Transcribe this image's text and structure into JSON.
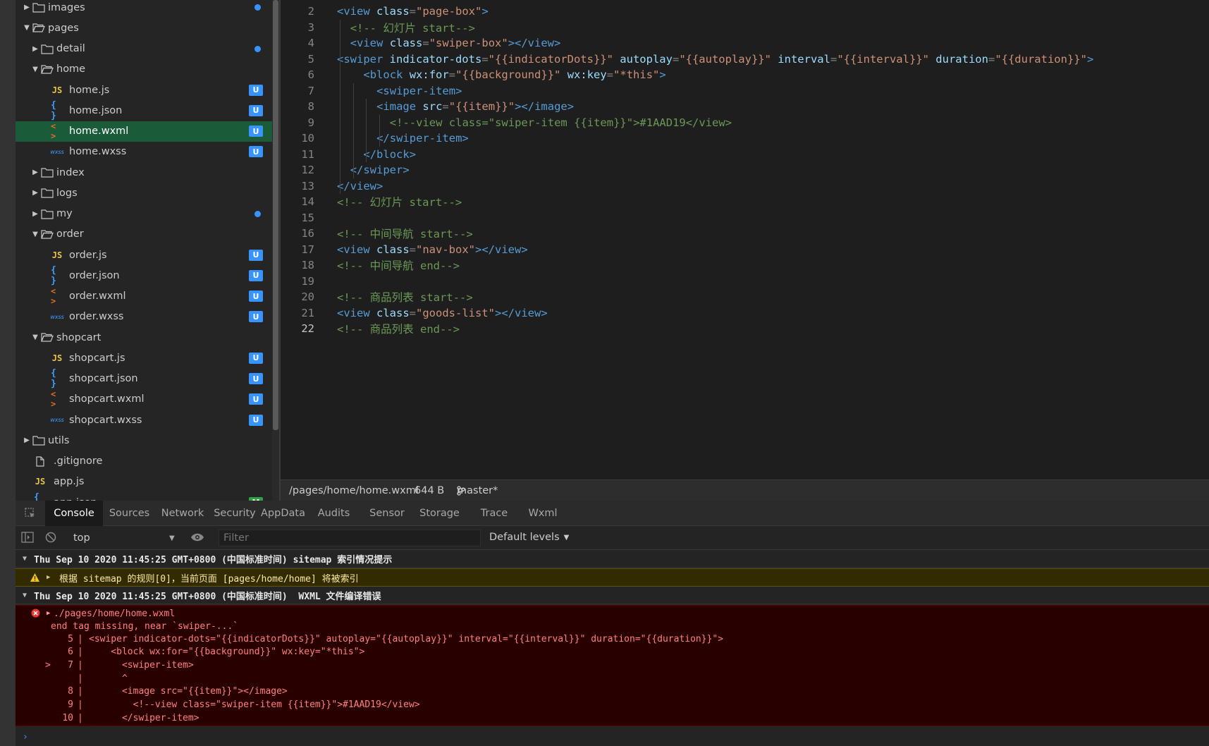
{
  "file_tree": {
    "items": [
      {
        "label": "images",
        "type": "folder",
        "expanded": false,
        "depth": 0,
        "status": "dot"
      },
      {
        "label": "pages",
        "type": "folder",
        "expanded": true,
        "depth": 0,
        "status": ""
      },
      {
        "label": "detail",
        "type": "folder",
        "expanded": false,
        "depth": 1,
        "status": "dot"
      },
      {
        "label": "home",
        "type": "folder",
        "expanded": true,
        "depth": 1,
        "status": ""
      },
      {
        "label": "home.js",
        "type": "js",
        "depth": 2,
        "status": "U"
      },
      {
        "label": "home.json",
        "type": "json",
        "depth": 2,
        "status": "U"
      },
      {
        "label": "home.wxml",
        "type": "wxml",
        "depth": 2,
        "status": "U",
        "active": true
      },
      {
        "label": "home.wxss",
        "type": "wxss",
        "depth": 2,
        "status": "U"
      },
      {
        "label": "index",
        "type": "folder",
        "expanded": false,
        "depth": 1,
        "status": ""
      },
      {
        "label": "logs",
        "type": "folder",
        "expanded": false,
        "depth": 1,
        "status": ""
      },
      {
        "label": "my",
        "type": "folder",
        "expanded": false,
        "depth": 1,
        "status": "dot"
      },
      {
        "label": "order",
        "type": "folder",
        "expanded": true,
        "depth": 1,
        "status": ""
      },
      {
        "label": "order.js",
        "type": "js",
        "depth": 2,
        "status": "U"
      },
      {
        "label": "order.json",
        "type": "json",
        "depth": 2,
        "status": "U"
      },
      {
        "label": "order.wxml",
        "type": "wxml",
        "depth": 2,
        "status": "U"
      },
      {
        "label": "order.wxss",
        "type": "wxss",
        "depth": 2,
        "status": "U"
      },
      {
        "label": "shopcart",
        "type": "folder",
        "expanded": true,
        "depth": 1,
        "status": ""
      },
      {
        "label": "shopcart.js",
        "type": "js",
        "depth": 2,
        "status": "U"
      },
      {
        "label": "shopcart.json",
        "type": "json",
        "depth": 2,
        "status": "U"
      },
      {
        "label": "shopcart.wxml",
        "type": "wxml",
        "depth": 2,
        "status": "U"
      },
      {
        "label": "shopcart.wxss",
        "type": "wxss",
        "depth": 2,
        "status": "U"
      },
      {
        "label": "utils",
        "type": "folder",
        "expanded": false,
        "depth": 0,
        "status": ""
      },
      {
        "label": ".gitignore",
        "type": "file",
        "depth": 0,
        "status": ""
      },
      {
        "label": "app.js",
        "type": "js",
        "depth": 0,
        "status": ""
      },
      {
        "label": "app.json",
        "type": "json",
        "depth": 0,
        "status": "M"
      }
    ]
  },
  "editor": {
    "current_line": 22,
    "lines": [
      {
        "n": "2",
        "indent": 0,
        "tokens": [
          [
            "tag",
            "<view "
          ],
          [
            "attr",
            "class"
          ],
          [
            "punc",
            "="
          ],
          [
            "str",
            "\"page-box\""
          ],
          [
            "tag",
            ">"
          ]
        ]
      },
      {
        "n": "3",
        "indent": 1,
        "tokens": [
          [
            "cmt",
            "<!-- 幻灯片 start-->"
          ]
        ]
      },
      {
        "n": "4",
        "indent": 1,
        "tokens": [
          [
            "tag",
            "<view "
          ],
          [
            "attr",
            "class"
          ],
          [
            "punc",
            "="
          ],
          [
            "str",
            "\"swiper-box\""
          ],
          [
            "tag",
            "></view>"
          ]
        ]
      },
      {
        "n": "5",
        "indent": 0,
        "tokens": [
          [
            "tag",
            "<swiper "
          ],
          [
            "attr",
            "indicator-dots"
          ],
          [
            "punc",
            "="
          ],
          [
            "str",
            "\"{{indicatorDots}}\""
          ],
          [
            "attr",
            " autoplay"
          ],
          [
            "punc",
            "="
          ],
          [
            "str",
            "\"{{autoplay}}\""
          ],
          [
            "attr",
            " interval"
          ],
          [
            "punc",
            "="
          ],
          [
            "str",
            "\"{{interval}}\""
          ],
          [
            "attr",
            " duration"
          ],
          [
            "punc",
            "="
          ],
          [
            "str",
            "\"{{duration}}\""
          ],
          [
            "tag",
            ">"
          ]
        ]
      },
      {
        "n": "6",
        "indent": 2,
        "tokens": [
          [
            "tag",
            "<block "
          ],
          [
            "attr",
            "wx:for"
          ],
          [
            "punc",
            "="
          ],
          [
            "str",
            "\"{{background}}\""
          ],
          [
            "attr",
            " wx:key"
          ],
          [
            "punc",
            "="
          ],
          [
            "str",
            "\"*this\""
          ],
          [
            "tag",
            ">"
          ]
        ]
      },
      {
        "n": "7",
        "indent": 3,
        "tokens": [
          [
            "tag",
            "<swiper-item>"
          ]
        ]
      },
      {
        "n": "8",
        "indent": 3,
        "tokens": [
          [
            "tag",
            "<image "
          ],
          [
            "attr",
            "src"
          ],
          [
            "punc",
            "="
          ],
          [
            "str",
            "\"{{item}}\""
          ],
          [
            "tag",
            "></image>"
          ]
        ]
      },
      {
        "n": "9",
        "indent": 4,
        "tokens": [
          [
            "cmt",
            "<!--view class=\"swiper-item {{item}}\">#1AAD19</view>"
          ]
        ]
      },
      {
        "n": "10",
        "indent": 3,
        "tokens": [
          [
            "tag",
            "</swiper-item>"
          ]
        ]
      },
      {
        "n": "11",
        "indent": 2,
        "tokens": [
          [
            "tag",
            "</block>"
          ]
        ]
      },
      {
        "n": "12",
        "indent": 1,
        "tokens": [
          [
            "tag",
            "</swiper>"
          ]
        ]
      },
      {
        "n": "13",
        "indent": 0,
        "tokens": [
          [
            "tag",
            "</view>"
          ]
        ]
      },
      {
        "n": "14",
        "indent": 0,
        "tokens": [
          [
            "cmt",
            "<!-- 幻灯片 start-->"
          ]
        ]
      },
      {
        "n": "15",
        "indent": 0,
        "tokens": []
      },
      {
        "n": "16",
        "indent": 0,
        "tokens": [
          [
            "cmt",
            "<!-- 中间导航 start-->"
          ]
        ]
      },
      {
        "n": "17",
        "indent": 0,
        "tokens": [
          [
            "tag",
            "<view "
          ],
          [
            "attr",
            "class"
          ],
          [
            "punc",
            "="
          ],
          [
            "str",
            "\"nav-box\""
          ],
          [
            "tag",
            "></view>"
          ]
        ]
      },
      {
        "n": "18",
        "indent": 0,
        "tokens": [
          [
            "cmt",
            "<!-- 中间导航 end-->"
          ]
        ]
      },
      {
        "n": "19",
        "indent": 0,
        "tokens": []
      },
      {
        "n": "20",
        "indent": 0,
        "tokens": [
          [
            "cmt",
            "<!-- 商品列表 start-->"
          ]
        ]
      },
      {
        "n": "21",
        "indent": 0,
        "tokens": [
          [
            "tag",
            "<view "
          ],
          [
            "attr",
            "class"
          ],
          [
            "punc",
            "="
          ],
          [
            "str",
            "\"goods-list\""
          ],
          [
            "tag",
            "></view>"
          ]
        ]
      },
      {
        "n": "22",
        "indent": 0,
        "tokens": [
          [
            "cmt",
            "<!-- 商品列表 end-->"
          ]
        ]
      }
    ]
  },
  "statusbar": {
    "path": "/pages/home/home.wxml",
    "size": "644 B",
    "branch": "master*"
  },
  "devtools": {
    "tabs": [
      "Console",
      "Sources",
      "Network",
      "Security",
      "AppData",
      "Audits",
      "Sensor",
      "Storage",
      "Trace",
      "Wxml"
    ],
    "active_tab": "Console",
    "context": "top",
    "filter_placeholder": "Filter",
    "levels": "Default levels"
  },
  "console": {
    "group1_title": "Thu Sep 10 2020 11:45:25 GMT+0800 (中国标准时间) sitemap 索引情况提示",
    "warning": "根据 sitemap 的规则[0]，当前页面 [pages/home/home] 将被索引",
    "group2_title": "Thu Sep 10 2020 11:45:25 GMT+0800 (中国标准时间)  WXML 文件编译错误",
    "error_file": "./pages/home/home.wxml",
    "error_msg": "end tag missing, near `swiper-...`",
    "error_lines": [
      {
        "marker": "",
        "n": "5",
        "code": "<swiper indicator-dots=\"{{indicatorDots}}\" autoplay=\"{{autoplay}}\" interval=\"{{interval}}\" duration=\"{{duration}}\">"
      },
      {
        "marker": "",
        "n": "6",
        "code": "    <block wx:for=\"{{background}}\" wx:key=\"*this\">"
      },
      {
        "marker": ">",
        "n": "7",
        "code": "      <swiper-item>"
      },
      {
        "marker": "",
        "n": "",
        "code": "      ^"
      },
      {
        "marker": "",
        "n": "8",
        "code": "      <image src=\"{{item}}\"></image>"
      },
      {
        "marker": "",
        "n": "9",
        "code": "        <!--view class=\"swiper-item {{item}}\">#1AAD19</view>"
      },
      {
        "marker": "",
        "n": "10",
        "code": "      </swiper-item>"
      }
    ]
  },
  "colors": {
    "accent": "#3794ff",
    "active_row": "#1a5c3a",
    "error_bg": "#290000",
    "warning_bg": "#332b00"
  }
}
